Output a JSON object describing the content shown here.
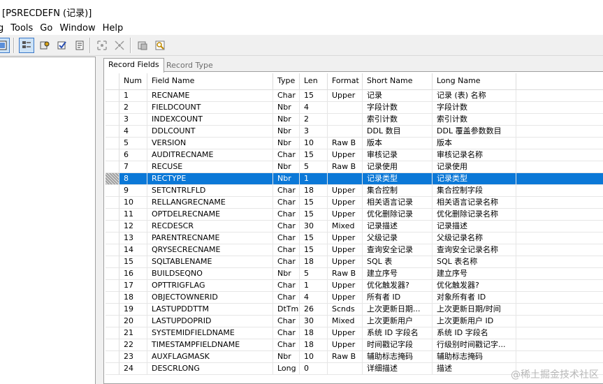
{
  "window": {
    "title": "[PSRECDEFN (记录)]"
  },
  "menu": {
    "items": [
      "g",
      "Tools",
      "Go",
      "Window",
      "Help"
    ]
  },
  "toolbar": {
    "buttons": [
      {
        "icon": "view-icon",
        "pressed": true
      },
      {
        "icon": "record-view-icon",
        "pressed": true
      },
      {
        "icon": "edit-icon",
        "pressed": false
      },
      {
        "icon": "validate-icon",
        "pressed": false
      },
      {
        "icon": "properties-icon",
        "pressed": false
      },
      {
        "icon": "expand-icon",
        "pressed": false
      },
      {
        "icon": "collapse-icon",
        "pressed": false
      },
      {
        "icon": "insert-icon",
        "pressed": false
      },
      {
        "icon": "find-icon",
        "pressed": false
      }
    ]
  },
  "tabs": {
    "active": "Record Fields",
    "inactive": "Record Type"
  },
  "columns": {
    "num": "Num",
    "field": "Field Name",
    "type": "Type",
    "len": "Len",
    "format": "Format",
    "short": "Short Name",
    "long": "Long Name"
  },
  "rows": [
    {
      "num": "1",
      "field": "RECNAME",
      "type": "Char",
      "len": "15",
      "format": "Upper",
      "short": "记录",
      "long": "记录 (表) 名称"
    },
    {
      "num": "2",
      "field": "FIELDCOUNT",
      "type": "Nbr",
      "len": "4",
      "format": "",
      "short": "字段计数",
      "long": "字段计数"
    },
    {
      "num": "3",
      "field": "INDEXCOUNT",
      "type": "Nbr",
      "len": "2",
      "format": "",
      "short": "索引计数",
      "long": "索引计数"
    },
    {
      "num": "4",
      "field": "DDLCOUNT",
      "type": "Nbr",
      "len": "3",
      "format": "",
      "short": "DDL 数目",
      "long": "DDL 覆盖参数数目"
    },
    {
      "num": "5",
      "field": "VERSION",
      "type": "Nbr",
      "len": "10",
      "format": "Raw B",
      "short": "版本",
      "long": "版本"
    },
    {
      "num": "6",
      "field": "AUDITRECNAME",
      "type": "Char",
      "len": "15",
      "format": "Upper",
      "short": "审核记录",
      "long": "审核记录名称"
    },
    {
      "num": "7",
      "field": "RECUSE",
      "type": "Nbr",
      "len": "5",
      "format": "Raw B",
      "short": "记录使用",
      "long": "记录使用"
    },
    {
      "num": "8",
      "field": "RECTYPE",
      "type": "Nbr",
      "len": "1",
      "format": "",
      "short": "记录类型",
      "long": "记录类型",
      "selected": true
    },
    {
      "num": "9",
      "field": "SETCNTRLFLD",
      "type": "Char",
      "len": "18",
      "format": "Upper",
      "short": "集合控制",
      "long": "集合控制字段"
    },
    {
      "num": "10",
      "field": "RELLANGRECNAME",
      "type": "Char",
      "len": "15",
      "format": "Upper",
      "short": "相关语言记录",
      "long": "相关语言记录名称"
    },
    {
      "num": "11",
      "field": "OPTDELRECNAME",
      "type": "Char",
      "len": "15",
      "format": "Upper",
      "short": "优化删除记录",
      "long": "优化删除记录名称"
    },
    {
      "num": "12",
      "field": "RECDESCR",
      "type": "Char",
      "len": "30",
      "format": "Mixed",
      "short": "记录描述",
      "long": "记录描述"
    },
    {
      "num": "13",
      "field": "PARENTRECNAME",
      "type": "Char",
      "len": "15",
      "format": "Upper",
      "short": "父级记录",
      "long": "父级记录名称"
    },
    {
      "num": "14",
      "field": "QRYSECRECNAME",
      "type": "Char",
      "len": "15",
      "format": "Upper",
      "short": "查询安全记录",
      "long": "查询安全记录名称"
    },
    {
      "num": "15",
      "field": "SQLTABLENAME",
      "type": "Char",
      "len": "18",
      "format": "Upper",
      "short": "SQL 表",
      "long": "SQL 表名称"
    },
    {
      "num": "16",
      "field": "BUILDSEQNO",
      "type": "Nbr",
      "len": "5",
      "format": "Raw B",
      "short": "建立序号",
      "long": "建立序号"
    },
    {
      "num": "17",
      "field": "OPTTRIGFLAG",
      "type": "Char",
      "len": "1",
      "format": "Upper",
      "short": "优化触发器?",
      "long": "优化触发器?"
    },
    {
      "num": "18",
      "field": "OBJECTOWNERID",
      "type": "Char",
      "len": "4",
      "format": "Upper",
      "short": "所有者 ID",
      "long": "对象所有者 ID"
    },
    {
      "num": "19",
      "field": "LASTUPDDTTM",
      "type": "DtTm",
      "len": "26",
      "format": "Scnds",
      "short": "上次更新日期...",
      "long": "上次更新日期/时间"
    },
    {
      "num": "20",
      "field": "LASTUPDOPRID",
      "type": "Char",
      "len": "30",
      "format": "Mixed",
      "short": "上次更新用户",
      "long": "上次更新用户 ID"
    },
    {
      "num": "21",
      "field": "SYSTEMIDFIELDNAME",
      "type": "Char",
      "len": "18",
      "format": "Upper",
      "short": "系统 ID 字段名",
      "long": "系统 ID 字段名"
    },
    {
      "num": "22",
      "field": "TIMESTAMPFIELDNAME",
      "type": "Char",
      "len": "18",
      "format": "Upper",
      "short": "时间戳记字段",
      "long": "行级别时间戳记字..."
    },
    {
      "num": "23",
      "field": "AUXFLAGMASK",
      "type": "Nbr",
      "len": "10",
      "format": "Raw B",
      "short": "辅助标志掩码",
      "long": "辅助标志掩码"
    },
    {
      "num": "24",
      "field": "DESCRLONG",
      "type": "Long",
      "len": "0",
      "format": "",
      "short": "详细描述",
      "long": "描述"
    }
  ],
  "watermark": "@稀土掘金技术社区"
}
